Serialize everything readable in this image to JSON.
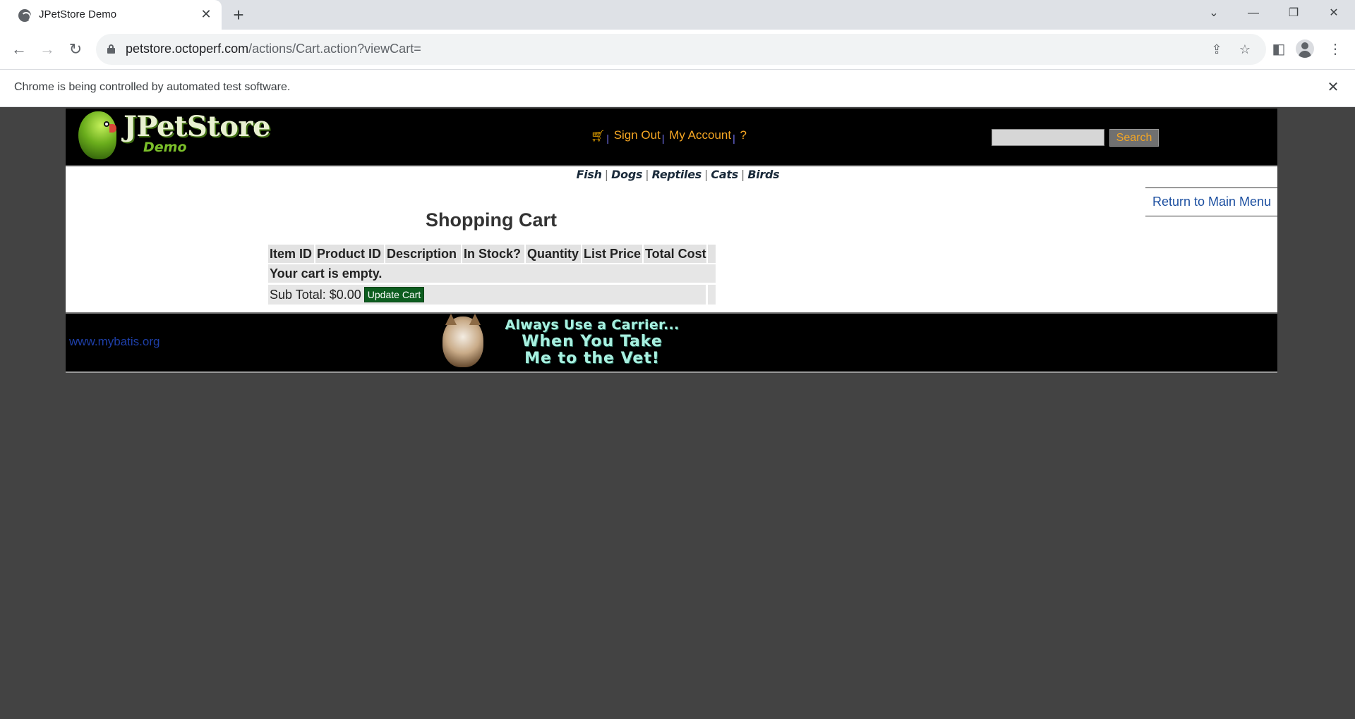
{
  "browser": {
    "tab_title": "JPetStore Demo",
    "tab_close": "✕",
    "new_tab": "+",
    "url_host": "petstore.octoperf.com",
    "url_path": "/actions/Cart.action?viewCart=",
    "infobar_text": "Chrome is being controlled by automated test software.",
    "infobar_close": "✕",
    "icons": [
      "globe-icon",
      "back-icon",
      "forward-icon",
      "reload-icon",
      "lock-icon",
      "share-icon",
      "star-icon",
      "sidepanel-icon",
      "profile-icon",
      "kebab-menu-icon",
      "chevron-down-icon",
      "minimize-icon",
      "restore-icon",
      "close-icon"
    ]
  },
  "header": {
    "logo_title": "JPetStore",
    "logo_subtitle": "Demo",
    "sign_out": "Sign Out",
    "my_account": "My Account",
    "help": "?",
    "separator": "|",
    "search_placeholder": "",
    "search_button": "Search"
  },
  "quicklinks": {
    "items": [
      "Fish",
      "Dogs",
      "Reptiles",
      "Cats",
      "Birds"
    ],
    "separator": "|"
  },
  "main": {
    "return_link": "Return to Main Menu",
    "cart_title": "Shopping Cart",
    "columns": [
      "Item ID",
      "Product ID",
      "Description",
      "In Stock?",
      "Quantity",
      "List Price",
      "Total Cost"
    ],
    "empty_message": "Your cart is empty.",
    "subtotal_label": "Sub Total: $0.00",
    "update_button": "Update Cart"
  },
  "footer": {
    "link": "www.mybatis.org",
    "banner_line1": "Always Use a Carrier...",
    "banner_line2": "When You Take",
    "banner_line3": "Me to the Vet!"
  },
  "colors": {
    "page_background": "#434343",
    "header_background": "#000000",
    "menu_link": "#f5a623",
    "update_button": "#0d5d1f",
    "return_link": "#1c4fa0",
    "footer_link": "#1e3fa8"
  }
}
